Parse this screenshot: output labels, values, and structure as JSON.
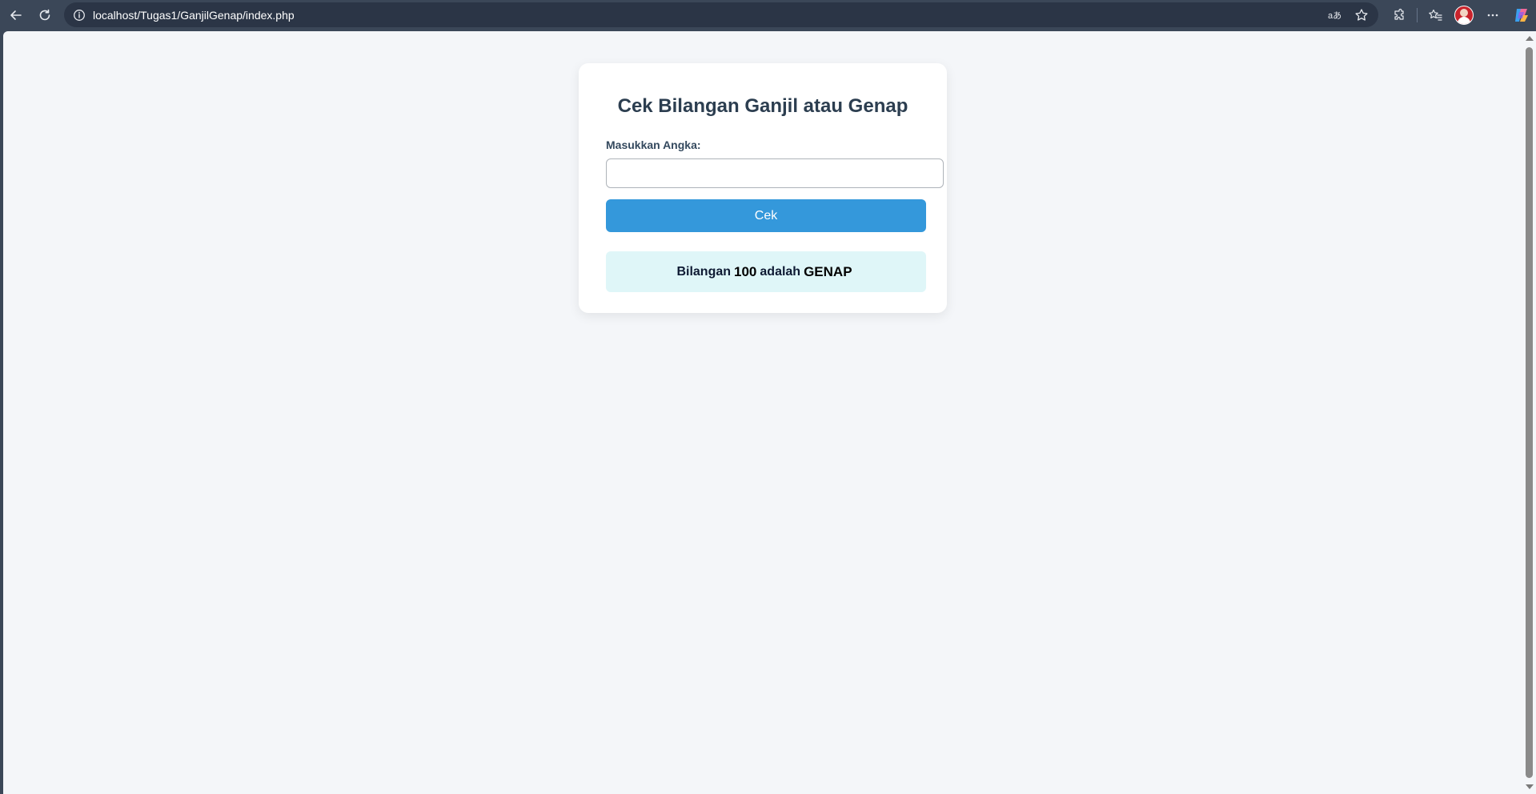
{
  "browser": {
    "url": "localhost/Tugas1/GanjilGenap/index.php",
    "icons": [
      "back-icon",
      "reload-icon",
      "site-info-icon",
      "read-aloud-icon",
      "favorite-star-icon",
      "extensions-icon",
      "favorites-icon",
      "profile-avatar",
      "more-icon",
      "copilot-icon"
    ]
  },
  "page": {
    "title": "Cek Bilangan Ganjil atau Genap",
    "form": {
      "label": "Masukkan Angka:",
      "input_value": "",
      "button_label": "Cek"
    },
    "result": {
      "prefix": "Bilangan",
      "number": "100",
      "middle": "adalah",
      "verdict": "GENAP"
    }
  },
  "colors": {
    "toolbar": "#3b4758",
    "page_bg": "#f4f6f9",
    "title": "#2c3e50",
    "button": "#3498db",
    "result_bg": "#dff6f8"
  }
}
